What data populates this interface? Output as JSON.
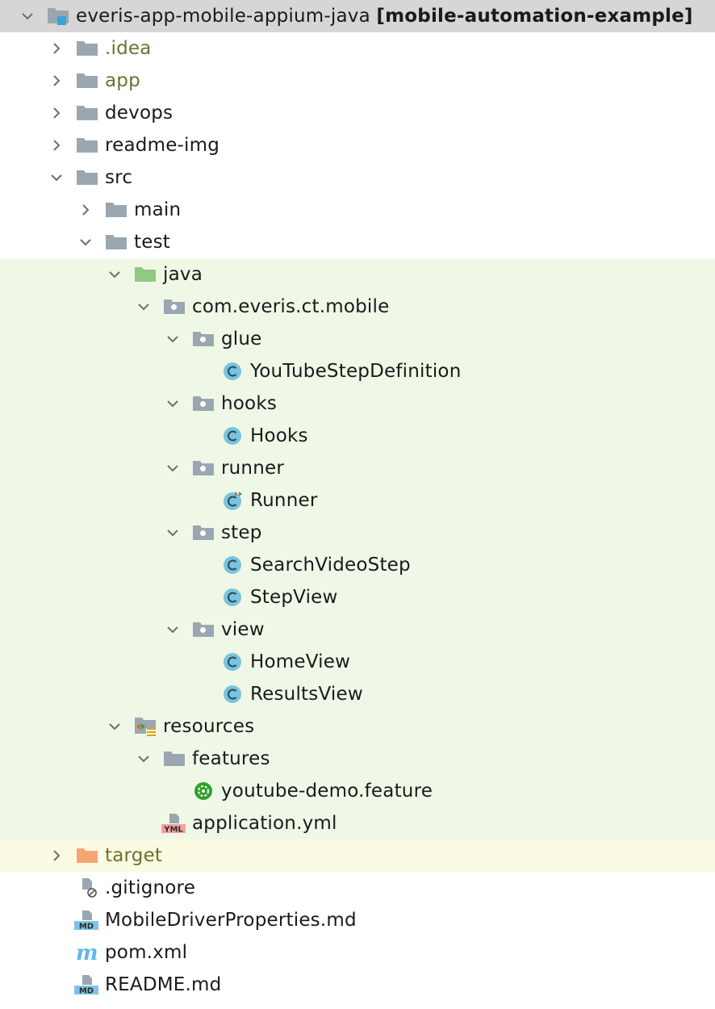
{
  "colors": {
    "selection_bg": "#d6d6d6",
    "test_source_bg": "#eff8e6",
    "excluded_bg": "#fbfbe3",
    "folder_gray": "#9aa7b0",
    "test_folder_green": "#8fc982",
    "excluded_folder_orange": "#f4a574",
    "class_icon_blue": "#79c3dd",
    "cucumber_green": "#2fa12f",
    "ignored_text_olive": "#707030"
  },
  "tree": {
    "root": {
      "name": "everis-app-mobile-appium-java",
      "module": "[mobile-automation-example]",
      "icon": "module-folder-icon"
    },
    "idea": {
      "name": ".idea",
      "icon": "folder-icon"
    },
    "app": {
      "name": "app",
      "icon": "folder-icon"
    },
    "devops": {
      "name": "devops",
      "icon": "folder-icon"
    },
    "readme_img": {
      "name": "readme-img",
      "icon": "folder-icon"
    },
    "src": {
      "name": "src",
      "icon": "folder-icon"
    },
    "main": {
      "name": "main",
      "icon": "folder-icon"
    },
    "test": {
      "name": "test",
      "icon": "folder-icon"
    },
    "java": {
      "name": "java",
      "icon": "test-sources-folder-icon"
    },
    "pkg": {
      "name": "com.everis.ct.mobile",
      "icon": "package-icon"
    },
    "glue": {
      "name": "glue",
      "icon": "package-icon"
    },
    "youtube_step_def": {
      "name": "YouTubeStepDefinition",
      "icon": "class-icon"
    },
    "hooks": {
      "name": "hooks",
      "icon": "package-icon"
    },
    "hooks_class": {
      "name": "Hooks",
      "icon": "class-icon"
    },
    "runner": {
      "name": "runner",
      "icon": "package-icon"
    },
    "runner_class": {
      "name": "Runner",
      "icon": "runnable-class-icon"
    },
    "step": {
      "name": "step",
      "icon": "package-icon"
    },
    "search_video_step": {
      "name": "SearchVideoStep",
      "icon": "class-icon"
    },
    "step_view": {
      "name": "StepView",
      "icon": "class-icon"
    },
    "view": {
      "name": "view",
      "icon": "package-icon"
    },
    "home_view": {
      "name": "HomeView",
      "icon": "class-icon"
    },
    "results_view": {
      "name": "ResultsView",
      "icon": "class-icon"
    },
    "resources": {
      "name": "resources",
      "icon": "test-resources-folder-icon"
    },
    "features": {
      "name": "features",
      "icon": "folder-icon"
    },
    "youtube_feature": {
      "name": "youtube-demo.feature",
      "icon": "cucumber-icon"
    },
    "application_yml": {
      "name": "application.yml",
      "icon": "yml-file-icon",
      "badge": "YML"
    },
    "target": {
      "name": "target",
      "icon": "excluded-folder-icon"
    },
    "gitignore": {
      "name": ".gitignore",
      "icon": "ignore-file-icon"
    },
    "mobile_driver_md": {
      "name": "MobileDriverProperties.md",
      "icon": "markdown-file-icon",
      "badge": "MD"
    },
    "pom_xml": {
      "name": "pom.xml",
      "icon": "maven-icon",
      "badge": "m"
    },
    "readme_md": {
      "name": "README.md",
      "icon": "markdown-file-icon",
      "badge": "MD"
    }
  }
}
